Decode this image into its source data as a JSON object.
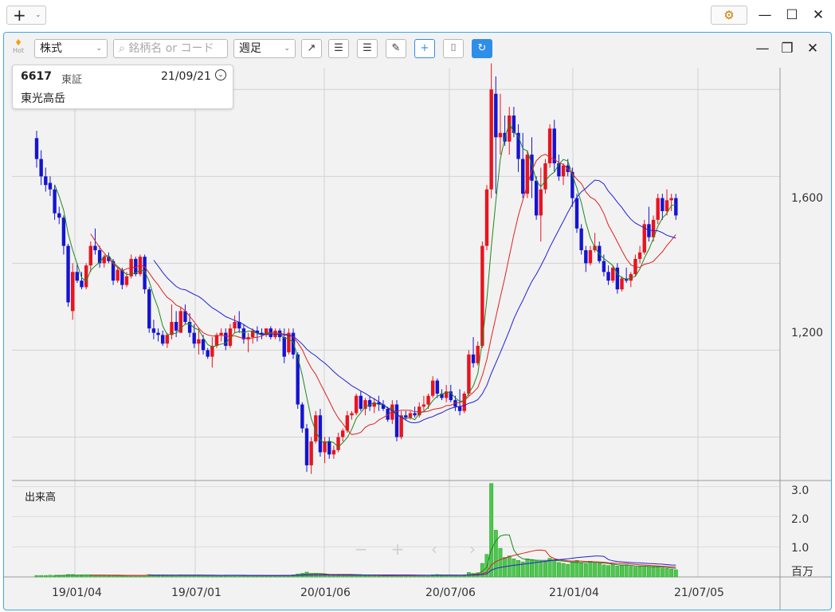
{
  "titlebar": {
    "add_tab_label": "+",
    "add_tab_caret": "⌄",
    "settings_icon": "gear-icon",
    "settings_glyph": "⚙",
    "minimize_glyph": "—",
    "maximize_glyph": "☐",
    "close_glyph": "✕"
  },
  "toolbar": {
    "hot_label": "Hot",
    "market_type": "株式",
    "search_placeholder": "銘柄名 or コード",
    "period": "週足",
    "window_minimize": "—",
    "window_restore": "❐",
    "window_close": "✕"
  },
  "stock": {
    "code": "6617",
    "exchange": "東証",
    "date": "21/09/21",
    "name": "東光高岳"
  },
  "chart_data": {
    "type": "candlestick",
    "period": "weekly",
    "price_axis": {
      "ticks": [
        "1,600",
        "1,200"
      ],
      "range": [
        900,
        1850
      ]
    },
    "volume_axis": {
      "label": "出来高",
      "unit": "百万",
      "ticks": [
        "3.0",
        "2.0",
        "1.0"
      ],
      "range": [
        0,
        3.2
      ]
    },
    "x_ticks": [
      "19/01/04",
      "19/07/01",
      "20/01/06",
      "20/07/06",
      "21/01/04",
      "21/07/05"
    ],
    "up_color": "#e8141e",
    "down_color": "#1414d2",
    "ma_colors": [
      "#1a8a1a",
      "#e02020",
      "#2020d8"
    ],
    "volume_color": "#4cc84c",
    "weeks": [
      [
        1688,
        1705,
        1620,
        1640
      ],
      [
        1640,
        1660,
        1580,
        1600
      ],
      [
        1600,
        1620,
        1565,
        1580
      ],
      [
        1585,
        1600,
        1555,
        1570
      ],
      [
        1570,
        1580,
        1500,
        1515
      ],
      [
        1515,
        1530,
        1490,
        1505
      ],
      [
        1505,
        1510,
        1420,
        1440
      ],
      [
        1440,
        1445,
        1300,
        1310
      ],
      [
        1290,
        1400,
        1270,
        1380
      ],
      [
        1380,
        1400,
        1355,
        1360
      ],
      [
        1360,
        1380,
        1340,
        1345
      ],
      [
        1345,
        1400,
        1340,
        1395
      ],
      [
        1395,
        1450,
        1380,
        1440
      ],
      [
        1440,
        1480,
        1420,
        1430
      ],
      [
        1430,
        1440,
        1390,
        1400
      ],
      [
        1400,
        1420,
        1390,
        1415
      ],
      [
        1415,
        1425,
        1400,
        1405
      ],
      [
        1405,
        1410,
        1350,
        1360
      ],
      [
        1360,
        1390,
        1355,
        1385
      ],
      [
        1385,
        1390,
        1340,
        1350
      ],
      [
        1350,
        1380,
        1345,
        1370
      ],
      [
        1370,
        1420,
        1365,
        1410
      ],
      [
        1410,
        1415,
        1370,
        1375
      ],
      [
        1375,
        1420,
        1370,
        1415
      ],
      [
        1415,
        1420,
        1330,
        1340
      ],
      [
        1340,
        1345,
        1240,
        1250
      ],
      [
        1250,
        1270,
        1225,
        1240
      ],
      [
        1240,
        1250,
        1220,
        1235
      ],
      [
        1235,
        1245,
        1210,
        1215
      ],
      [
        1215,
        1240,
        1205,
        1235
      ],
      [
        1235,
        1305,
        1225,
        1265
      ],
      [
        1265,
        1290,
        1230,
        1245
      ],
      [
        1240,
        1300,
        1240,
        1290
      ],
      [
        1290,
        1305,
        1260,
        1265
      ],
      [
        1265,
        1285,
        1230,
        1240
      ],
      [
        1240,
        1260,
        1205,
        1215
      ],
      [
        1215,
        1250,
        1190,
        1225
      ],
      [
        1225,
        1235,
        1190,
        1200
      ],
      [
        1200,
        1205,
        1180,
        1185
      ],
      [
        1185,
        1230,
        1160,
        1210
      ],
      [
        1210,
        1240,
        1205,
        1235
      ],
      [
        1235,
        1250,
        1220,
        1240
      ],
      [
        1240,
        1250,
        1200,
        1210
      ],
      [
        1210,
        1260,
        1205,
        1250
      ],
      [
        1250,
        1280,
        1240,
        1265
      ],
      [
        1265,
        1290,
        1240,
        1250
      ],
      [
        1250,
        1260,
        1215,
        1225
      ],
      [
        1225,
        1240,
        1195,
        1230
      ],
      [
        1230,
        1250,
        1215,
        1245
      ],
      [
        1245,
        1255,
        1220,
        1240
      ],
      [
        1240,
        1250,
        1225,
        1235
      ],
      [
        1235,
        1250,
        1230,
        1250
      ],
      [
        1250,
        1255,
        1225,
        1230
      ],
      [
        1230,
        1250,
        1225,
        1245
      ],
      [
        1245,
        1250,
        1220,
        1230
      ],
      [
        1230,
        1250,
        1170,
        1185
      ],
      [
        1195,
        1250,
        1190,
        1240
      ],
      [
        1240,
        1250,
        1180,
        1190
      ],
      [
        1190,
        1195,
        1065,
        1075
      ],
      [
        1075,
        1080,
        1010,
        1020
      ],
      [
        1020,
        1030,
        920,
        935
      ],
      [
        935,
        1000,
        915,
        990
      ],
      [
        990,
        1060,
        985,
        1050
      ],
      [
        1050,
        1065,
        955,
        965
      ],
      [
        965,
        1000,
        940,
        990
      ],
      [
        990,
        1000,
        950,
        960
      ],
      [
        960,
        980,
        950,
        970
      ],
      [
        970,
        1010,
        965,
        1000
      ],
      [
        1000,
        1020,
        990,
        1015
      ],
      [
        1015,
        1060,
        1010,
        1050
      ],
      [
        1050,
        1060,
        1040,
        1055
      ],
      [
        1055,
        1100,
        1050,
        1095
      ],
      [
        1095,
        1105,
        1060,
        1065
      ],
      [
        1065,
        1090,
        1050,
        1085
      ],
      [
        1085,
        1095,
        1060,
        1070
      ],
      [
        1070,
        1090,
        1055,
        1080
      ],
      [
        1080,
        1095,
        1060,
        1075
      ],
      [
        1075,
        1085,
        1060,
        1065
      ],
      [
        1065,
        1070,
        1035,
        1040
      ],
      [
        1040,
        1085,
        1030,
        1075
      ],
      [
        1075,
        1085,
        990,
        1000
      ],
      [
        1000,
        1060,
        995,
        1050
      ],
      [
        1050,
        1060,
        1040,
        1045
      ],
      [
        1045,
        1060,
        1040,
        1055
      ],
      [
        1055,
        1070,
        1045,
        1050
      ],
      [
        1050,
        1080,
        1045,
        1070
      ],
      [
        1070,
        1095,
        1060,
        1075
      ],
      [
        1075,
        1100,
        1065,
        1095
      ],
      [
        1095,
        1140,
        1090,
        1130
      ],
      [
        1130,
        1135,
        1090,
        1100
      ],
      [
        1100,
        1110,
        1085,
        1090
      ],
      [
        1090,
        1120,
        1080,
        1105
      ],
      [
        1105,
        1120,
        1080,
        1085
      ],
      [
        1085,
        1095,
        1060,
        1070
      ],
      [
        1070,
        1110,
        1050,
        1060
      ],
      [
        1060,
        1105,
        1055,
        1100
      ],
      [
        1100,
        1200,
        1095,
        1190
      ],
      [
        1190,
        1230,
        1160,
        1170
      ],
      [
        1170,
        1220,
        1165,
        1210
      ],
      [
        1210,
        1450,
        1205,
        1440
      ],
      [
        1440,
        1580,
        1430,
        1570
      ],
      [
        1570,
        1860,
        1550,
        1800
      ],
      [
        1790,
        1830,
        1560,
        1690
      ],
      [
        1690,
        1790,
        1650,
        1700
      ],
      [
        1700,
        1740,
        1670,
        1680
      ],
      [
        1680,
        1760,
        1650,
        1740
      ],
      [
        1740,
        1760,
        1690,
        1700
      ],
      [
        1700,
        1720,
        1610,
        1640
      ],
      [
        1640,
        1700,
        1550,
        1560
      ],
      [
        1560,
        1660,
        1550,
        1650
      ],
      [
        1650,
        1690,
        1550,
        1590
      ],
      [
        1590,
        1600,
        1500,
        1510
      ],
      [
        1510,
        1620,
        1450,
        1570
      ],
      [
        1570,
        1640,
        1560,
        1630
      ],
      [
        1630,
        1720,
        1620,
        1710
      ],
      [
        1710,
        1730,
        1610,
        1630
      ],
      [
        1630,
        1650,
        1590,
        1600
      ],
      [
        1600,
        1630,
        1580,
        1625
      ],
      [
        1625,
        1640,
        1600,
        1610
      ],
      [
        1610,
        1620,
        1530,
        1550
      ],
      [
        1550,
        1560,
        1470,
        1480
      ],
      [
        1480,
        1490,
        1420,
        1430
      ],
      [
        1430,
        1440,
        1380,
        1400
      ],
      [
        1400,
        1440,
        1395,
        1430
      ],
      [
        1430,
        1470,
        1425,
        1440
      ],
      [
        1440,
        1450,
        1400,
        1405
      ],
      [
        1405,
        1420,
        1370,
        1380
      ],
      [
        1380,
        1395,
        1350,
        1360
      ],
      [
        1360,
        1395,
        1355,
        1390
      ],
      [
        1390,
        1400,
        1330,
        1340
      ],
      [
        1340,
        1370,
        1335,
        1365
      ],
      [
        1365,
        1390,
        1355,
        1360
      ],
      [
        1360,
        1380,
        1345,
        1375
      ],
      [
        1375,
        1420,
        1370,
        1410
      ],
      [
        1410,
        1440,
        1400,
        1425
      ],
      [
        1425,
        1500,
        1420,
        1490
      ],
      [
        1490,
        1530,
        1450,
        1460
      ],
      [
        1460,
        1510,
        1450,
        1500
      ],
      [
        1500,
        1560,
        1490,
        1550
      ],
      [
        1550,
        1560,
        1500,
        1520
      ],
      [
        1520,
        1570,
        1510,
        1545
      ],
      [
        1545,
        1560,
        1520,
        1550
      ],
      [
        1550,
        1560,
        1500,
        1510
      ]
    ],
    "volume": [
      0.05,
      0.05,
      0.05,
      0.06,
      0.05,
      0.04,
      0.06,
      0.08,
      0.08,
      0.05,
      0.05,
      0.06,
      0.07,
      0.06,
      0.05,
      0.05,
      0.04,
      0.05,
      0.05,
      0.04,
      0.05,
      0.06,
      0.05,
      0.05,
      0.06,
      0.08,
      0.07,
      0.06,
      0.05,
      0.05,
      0.06,
      0.05,
      0.07,
      0.06,
      0.05,
      0.06,
      0.05,
      0.05,
      0.04,
      0.06,
      0.05,
      0.04,
      0.05,
      0.05,
      0.06,
      0.05,
      0.04,
      0.04,
      0.05,
      0.05,
      0.04,
      0.04,
      0.05,
      0.05,
      0.04,
      0.06,
      0.06,
      0.07,
      0.1,
      0.12,
      0.16,
      0.11,
      0.09,
      0.08,
      0.07,
      0.06,
      0.05,
      0.05,
      0.05,
      0.06,
      0.05,
      0.05,
      0.06,
      0.05,
      0.05,
      0.05,
      0.05,
      0.04,
      0.05,
      0.05,
      0.06,
      0.06,
      0.05,
      0.05,
      0.05,
      0.05,
      0.06,
      0.06,
      0.07,
      0.08,
      0.06,
      0.05,
      0.06,
      0.05,
      0.05,
      0.07,
      0.15,
      0.12,
      0.14,
      0.45,
      0.75,
      3.1,
      1.55,
      0.95,
      0.65,
      0.7,
      0.6,
      0.55,
      0.5,
      0.6,
      0.58,
      0.55,
      0.52,
      0.5,
      0.62,
      0.58,
      0.48,
      0.45,
      0.42,
      0.5,
      0.55,
      0.48,
      0.44,
      0.52,
      0.48,
      0.45,
      0.4,
      0.38,
      0.42,
      0.36,
      0.38,
      0.4,
      0.35,
      0.33,
      0.34,
      0.36,
      0.35,
      0.32,
      0.33,
      0.3,
      0.28,
      0.26,
      0.24
    ]
  }
}
